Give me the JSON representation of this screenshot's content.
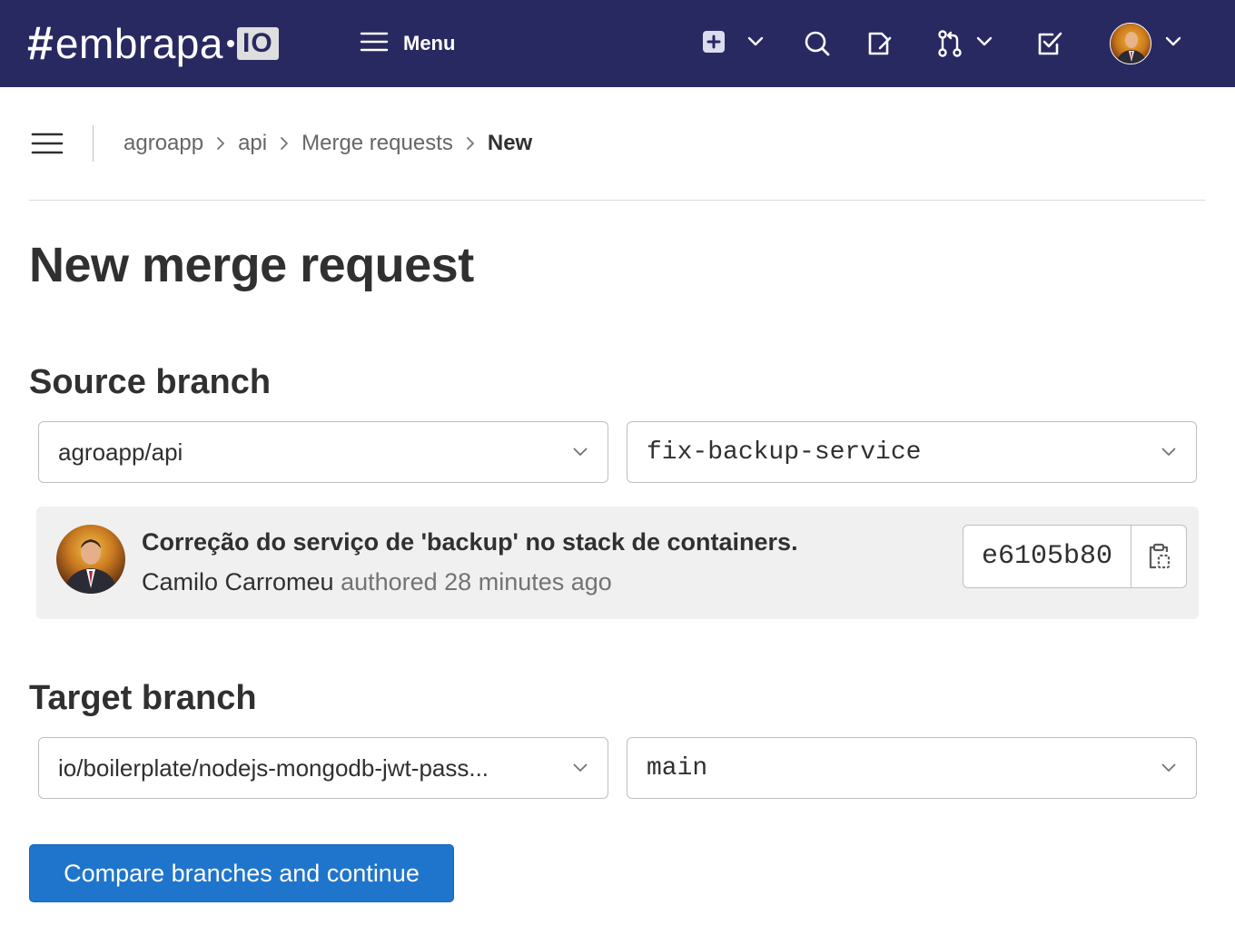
{
  "topbar": {
    "logo": {
      "hash": "#",
      "text": "embrapa",
      "badge": "IO"
    },
    "menu_label": "Menu",
    "icons": [
      "plus-square-icon",
      "search-icon",
      "issues-icon",
      "merge-request-icon",
      "todo-icon"
    ],
    "background": "#292961"
  },
  "breadcrumb": {
    "items": [
      "agroapp",
      "api",
      "Merge requests"
    ],
    "current": "New"
  },
  "page_title": "New merge request",
  "source": {
    "heading": "Source branch",
    "project": "agroapp/api",
    "branch": "fix-backup-service"
  },
  "commit": {
    "title": "Correção do serviço de 'backup' no stack de containers.",
    "author": "Camilo Carromeu",
    "authored_text": "authored 28 minutes ago",
    "sha": "e6105b80"
  },
  "target": {
    "heading": "Target branch",
    "project": "io/boilerplate/nodejs-mongodb-jwt-pass...",
    "branch": "main"
  },
  "submit_label": "Compare branches and continue",
  "colors": {
    "primary": "#1f75cb",
    "topbar": "#292961",
    "commit_bg": "#f0f0f0"
  }
}
